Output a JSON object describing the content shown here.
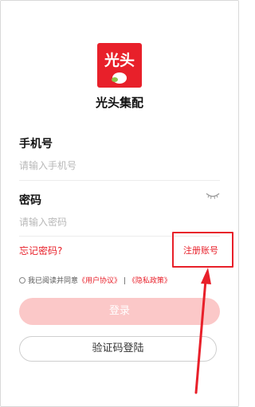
{
  "app": {
    "name": "光头集配",
    "logo_text": "光头",
    "brand_color": "#e8202a"
  },
  "form": {
    "phone_label": "手机号",
    "phone_placeholder": "请输入手机号",
    "password_label": "密码",
    "password_placeholder": "请输入密码",
    "password_toggle_icon": "eye-closed-icon"
  },
  "links": {
    "forgot_password": "忘记密码?",
    "register": "注册账号"
  },
  "agreement": {
    "prefix": "我已阅读并同意",
    "user_agreement": "《用户协议》",
    "separator": "|",
    "privacy_policy": "《隐私政策》"
  },
  "buttons": {
    "login": "登录",
    "code_login": "验证码登陆"
  },
  "annotation": {
    "highlight_color": "#e8202a",
    "arrow_icon": "arrow-up-icon"
  }
}
